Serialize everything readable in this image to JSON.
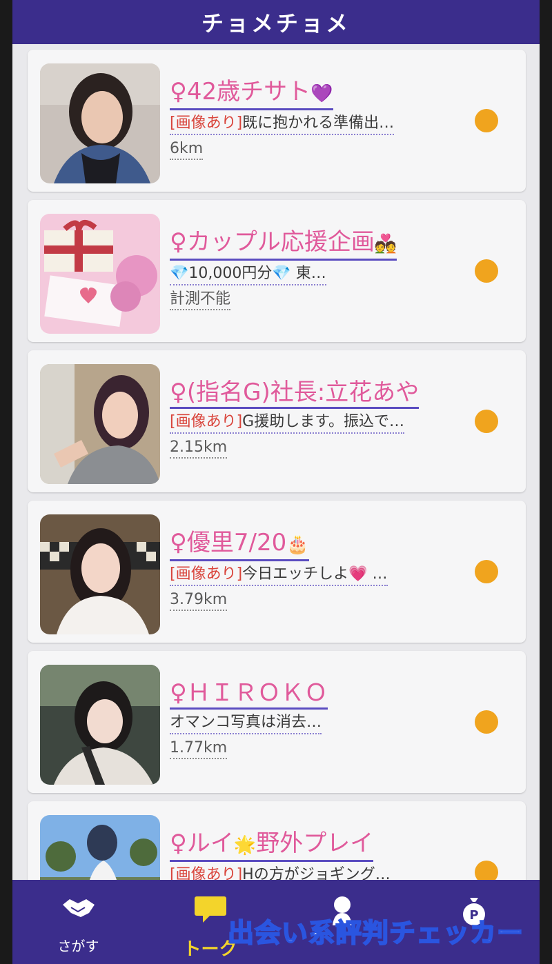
{
  "header": {
    "title": "チョメチョメ"
  },
  "conversations": [
    {
      "name": "♀42歳チサト",
      "emoji": "💜",
      "tag": "[画像あり]",
      "message": "既に抱かれる準備出…",
      "distance": "6km"
    },
    {
      "name": "♀カップル応援企画",
      "emoji": "💑",
      "tag": "",
      "message": "💎10,000円分💎 東…",
      "distance": "計測不能"
    },
    {
      "name": "♀(指名G)社長:立花あや",
      "emoji": "",
      "tag": "[画像あり]",
      "message": "G援助します。振込で…",
      "distance": "2.15km"
    },
    {
      "name": "♀優里7/20",
      "emoji": "🎂",
      "tag": "[画像あり]",
      "message": "今日エッチしよ💗 …",
      "distance": "3.79km"
    },
    {
      "name": "♀ＨＩＲＯＫＯ",
      "emoji": "",
      "tag": "",
      "message": "オマンコ写真は消去…",
      "distance": "1.77km"
    },
    {
      "name": "♀ルイ",
      "emoji": "🌟",
      "name_suffix": "野外プレイ",
      "tag": "[画像あり]",
      "message": "Hの方がジョギング…",
      "distance": ""
    }
  ],
  "tabbar": {
    "items": [
      {
        "label": "さがす",
        "icon": "handshake-icon"
      },
      {
        "label": "トーク",
        "icon": "chat-icon"
      },
      {
        "label": "",
        "icon": "person-icon"
      },
      {
        "label": "",
        "icon": "points-bag-icon"
      }
    ]
  },
  "watermark": "出会い系評判チェッカー",
  "colors": {
    "header": "#3b2d8c",
    "name": "#e05a9b",
    "unread_dot": "#f0a41e",
    "tag": "#d9443b",
    "active_tab": "#f3d42b"
  }
}
